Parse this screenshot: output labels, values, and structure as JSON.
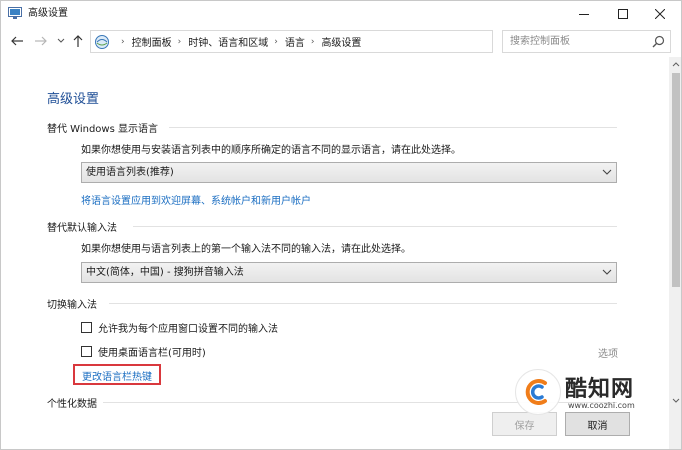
{
  "window": {
    "title": "高级设置",
    "controls": {
      "minimize": "minimize-icon",
      "maximize": "maximize-icon",
      "close": "close-icon"
    }
  },
  "navigation": {
    "breadcrumbs": [
      "控制面板",
      "时钟、语言和区域",
      "语言",
      "高级设置"
    ],
    "search_placeholder": "搜索控制面板"
  },
  "content": {
    "page_title": "高级设置",
    "display_language": {
      "header": "替代 Windows 显示语言",
      "description": "如果你想使用与安装语言列表中的顺序所确定的语言不同的显示语言，请在此处选择。",
      "selected": "使用语言列表(推荐)",
      "link": "将语言设置应用到欢迎屏幕、系统帐户和新用户帐户"
    },
    "default_input": {
      "header": "替代默认输入法",
      "description": "如果你想使用与语言列表上的第一个输入法不同的输入法，请在此处选择。",
      "selected": "中文(简体，中国) - 搜狗拼音输入法"
    },
    "switch_input": {
      "header": "切换输入法",
      "checkbox_per_app": "允许我为每个应用窗口设置不同的输入法",
      "checkbox_language_bar": "使用桌面语言栏(可用时)",
      "options_link": "选项",
      "hotkeys_link": "更改语言栏热键"
    },
    "personalization": {
      "header": "个性化数据"
    }
  },
  "footer": {
    "save_label": "保存",
    "cancel_label": "取消"
  },
  "watermark": {
    "brand": "酷知网",
    "url": "www.coozhi.com"
  },
  "colors": {
    "title_blue": "#1e4e96",
    "link_blue": "#1b6ec2",
    "highlight_red": "#d9383d"
  }
}
